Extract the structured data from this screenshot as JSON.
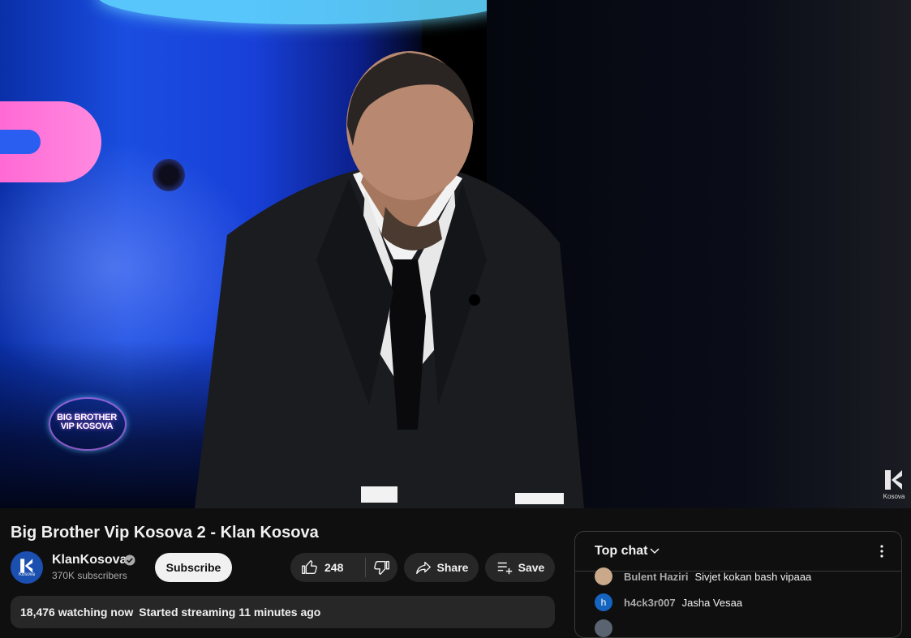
{
  "video": {
    "show_logo_line1": "BIG BROTHER",
    "show_logo_line2": "VIP KOSOVA",
    "watermark_caption": "Kosova"
  },
  "title": "Big Brother Vip Kosova 2 - Klan Kosova",
  "channel": {
    "name": "KlanKosova",
    "subscribers": "370K subscribers",
    "avatar_caption": "Kosova",
    "verified": true
  },
  "actions": {
    "subscribe_label": "Subscribe",
    "like_count": "248",
    "share_label": "Share",
    "save_label": "Save"
  },
  "description": {
    "watching": "18,476 watching now",
    "started": "Started streaming 11 minutes ago"
  },
  "chat": {
    "header": "Top chat",
    "messages": [
      {
        "author": "Bulent Haziri",
        "text": "Sivjet kokan bash vipaaa",
        "avatar": "",
        "avatar_color": "#c9a98a"
      },
      {
        "author": "h4ck3r007",
        "text": "Jasha Vesaa",
        "avatar": "h",
        "avatar_color": "#1565c0"
      }
    ]
  },
  "colors": {
    "background": "#0f0f0f",
    "pill": "#272727",
    "subscribe_bg": "#f1f1f1",
    "secondary_text": "#aaaaaa"
  },
  "icons": [
    "verified-icon",
    "thumbs-up-icon",
    "thumbs-down-icon",
    "share-icon",
    "save-playlist-icon",
    "chevron-down-icon",
    "more-vert-icon"
  ]
}
